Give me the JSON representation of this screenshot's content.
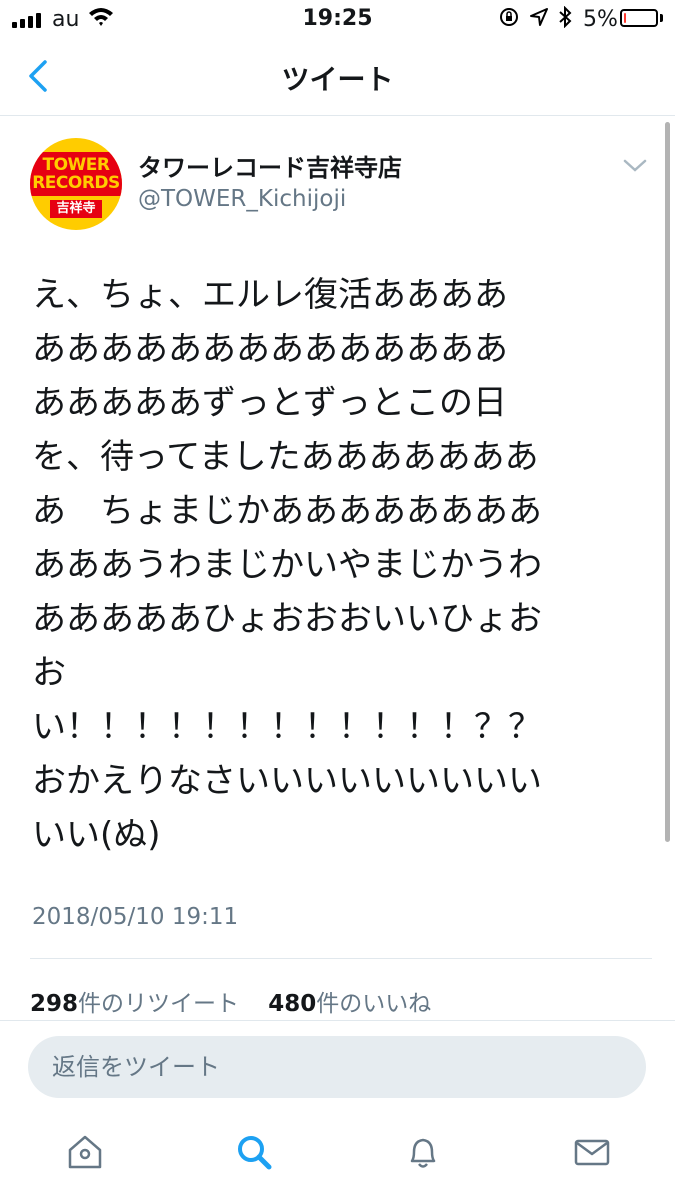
{
  "status_bar": {
    "carrier": "au",
    "time": "19:25",
    "battery_percent": "5%",
    "battery_level": 0.05
  },
  "nav": {
    "title": "ツイート"
  },
  "tweet": {
    "display_name": "タワーレコード吉祥寺店",
    "handle": "@TOWER_Kichijoji",
    "avatar_logo_lines": [
      "TOWER",
      "RECORDS"
    ],
    "avatar_logo_sub": "吉祥寺",
    "text_lines": [
      "え、ちょ、エルレ復活ああああ",
      "ああああああああああああああ",
      "あああああずっとずっとこの日",
      "を、待ってましたあああああああ",
      "あ　ちょまじかああああああああ",
      "あああうわまじかいやまじかうわ",
      "あああああひょおおおいいひょお",
      "お",
      "い！！！！！！！！！！！！？？",
      "おかえりなさいいいいいいいいい",
      "いい(ぬ)"
    ],
    "timestamp": "2018/05/10 19:11",
    "retweet_count": "298",
    "retweet_label": "件のリツイート",
    "like_count": "480",
    "like_label": "件のいいね"
  },
  "reply": {
    "placeholder": "返信をツイート"
  },
  "tabs": [
    {
      "icon": "home-icon"
    },
    {
      "icon": "search-icon",
      "active": true
    },
    {
      "icon": "bell-icon"
    },
    {
      "icon": "mail-icon"
    }
  ],
  "colors": {
    "accent": "#1da1f2",
    "secondary_text": "#657786",
    "avatar_red": "#e60012",
    "avatar_yellow": "#ffcc00"
  }
}
